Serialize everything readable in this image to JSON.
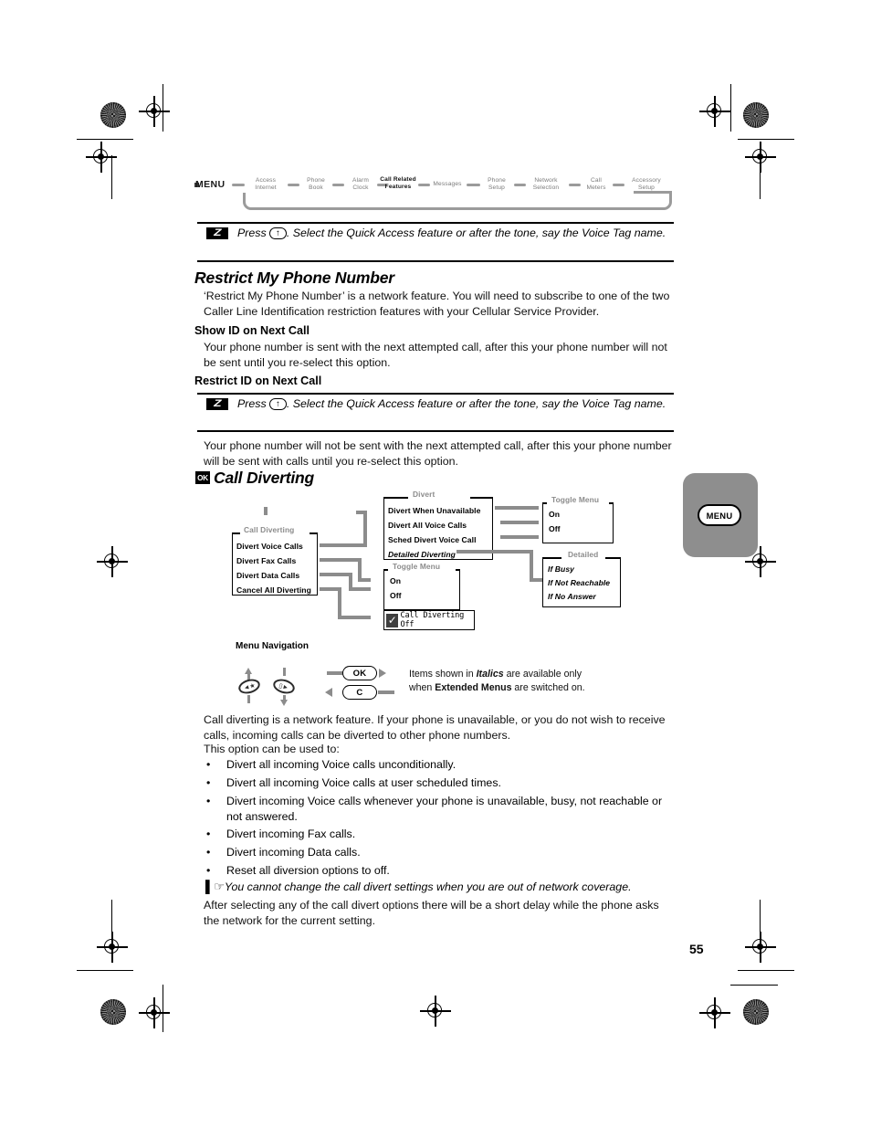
{
  "page": {
    "number": "55"
  },
  "breadcrumb": {
    "menu_label": "MENU",
    "items": [
      {
        "line1": "Access",
        "line2": "Internet",
        "active": false
      },
      {
        "line1": "Phone",
        "line2": "Book",
        "active": false
      },
      {
        "line1": "Alarm",
        "line2": "Clock",
        "active": false
      },
      {
        "line1": "Call Related",
        "line2": "Features",
        "active": true
      },
      {
        "line1": "Messages",
        "line2": "",
        "active": false
      },
      {
        "line1": "Phone",
        "line2": "Setup",
        "active": false
      },
      {
        "line1": "Network",
        "line2": "Selection",
        "active": false
      },
      {
        "line1": "Call",
        "line2": "Meters",
        "active": false
      },
      {
        "line1": "Accessory",
        "line2": "Setup",
        "active": false
      }
    ]
  },
  "note_top": {
    "icon": "voice-tag-icon",
    "text_before_key": "Press ",
    "key": "↑",
    "text_after_key": ". Select the Quick Access feature or after the tone, say the Voice Tag name."
  },
  "section_restrict": {
    "heading": "Restrict My Phone Number",
    "intro": "‘Restrict My Phone Number’ is a network feature. You will need to subscribe to one of the two Caller Line Identification restriction features with your Cellular Service Provider.",
    "sub1_heading": "Show ID on Next Call",
    "sub1_body": "Your phone number is sent with the next attempted call, after this your phone number will not be sent until you re-select this option.",
    "sub2_heading": "Restrict ID on Next Call",
    "sub2_body": "Your phone number will not be sent with the next attempted call, after this your phone number will be sent with calls until you re-select this option."
  },
  "note_second": {
    "icon": "voice-tag-icon",
    "text_before_key": "Press ",
    "key": "↑",
    "text_after_key": ". Select the Quick Access feature or after the tone, say the Voice Tag name."
  },
  "section_diverting": {
    "badge": "OK",
    "heading": "Call Diverting",
    "intro1": "Call diverting is a network feature. If your phone is unavailable, or you do not wish to receive calls, incoming calls can be diverted to other phone numbers.",
    "intro2": "This option can be used to:",
    "bullets": [
      "Divert all incoming Voice calls unconditionally.",
      "Divert all incoming Voice calls at user scheduled times.",
      "Divert incoming Voice calls whenever your phone is unavailable, busy, not reachable or not answered.",
      "Divert incoming Fax calls.",
      "Divert incoming Data calls.",
      "Reset all diversion options to off."
    ],
    "hand_note": "You cannot change the call divert settings when you are out of network coverage.",
    "closing": "After selecting any of the call divert options there will be a short delay while the phone asks the network for the current setting."
  },
  "diagram": {
    "box_call_diverting": {
      "caption": "Call Diverting",
      "items": [
        "Divert Voice Calls",
        "Divert Fax Calls",
        "Divert Data Calls",
        "Cancel All Diverting"
      ]
    },
    "box_divert": {
      "caption": "Divert",
      "items": [
        {
          "label": "Divert When Unavailable",
          "italic": false
        },
        {
          "label": "Divert All Voice Calls",
          "italic": false
        },
        {
          "label": "Sched Divert Voice Call",
          "italic": false
        },
        {
          "label": "Detailed Diverting",
          "italic": true
        }
      ]
    },
    "box_toggle_top": {
      "caption": "Toggle Menu",
      "items": [
        "On",
        "Off"
      ]
    },
    "box_toggle_mid": {
      "caption": "Toggle Menu",
      "items": [
        "On",
        "Off"
      ]
    },
    "box_detailed": {
      "caption": "Detailed",
      "items": [
        "If Busy",
        "If Not Reachable",
        "If No Answer"
      ]
    },
    "checkbox": {
      "label": "Call Diverting Off",
      "checked": true,
      "mark": "✓"
    }
  },
  "navigation_legend": {
    "title": "Menu Navigation",
    "ok_key": "OK",
    "clear_key": "C",
    "note_line1_a": "Items shown in ",
    "note_line1_italic": "Italics",
    "note_line1_b": " are available only",
    "note_line2_a": "when ",
    "note_line2_bold": "Extended Menus",
    "note_line2_b": " are switched on."
  },
  "side_tab": {
    "label": "MENU"
  },
  "colors": {
    "grey_connector": "#8c8c8c",
    "grey_caption": "#8c8c8c",
    "side_tab_bg": "#8e8e8e",
    "text": "#000000"
  }
}
